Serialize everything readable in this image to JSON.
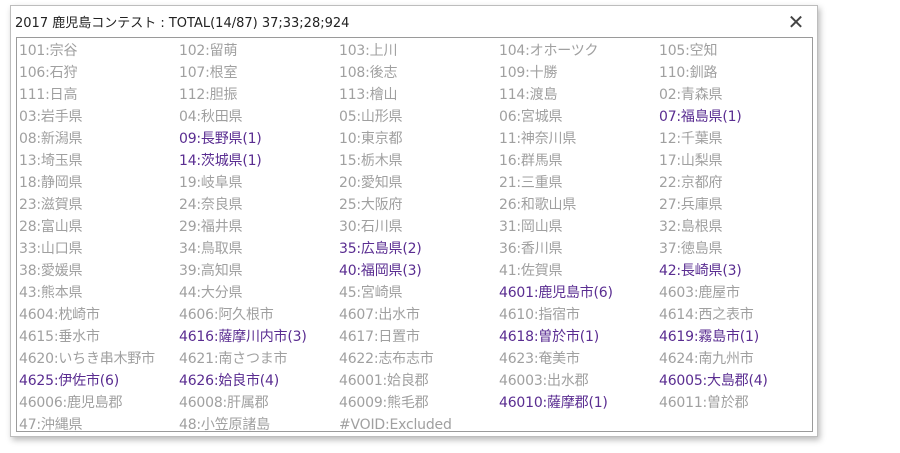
{
  "window": {
    "title": "2017 鹿児島コンテスト : TOTAL(14/87) 37;33;28;924",
    "close_glyph": "✕"
  },
  "colors": {
    "inactive": "#a0a0a0",
    "active": "#5a2d91"
  },
  "items": [
    {
      "label": "101:宗谷",
      "active": false
    },
    {
      "label": "102:留萌",
      "active": false
    },
    {
      "label": "103:上川",
      "active": false
    },
    {
      "label": "104:オホーツク",
      "active": false
    },
    {
      "label": "105:空知",
      "active": false
    },
    {
      "label": "106:石狩",
      "active": false
    },
    {
      "label": "107:根室",
      "active": false
    },
    {
      "label": "108:後志",
      "active": false
    },
    {
      "label": "109:十勝",
      "active": false
    },
    {
      "label": "110:釧路",
      "active": false
    },
    {
      "label": "111:日高",
      "active": false
    },
    {
      "label": "112:胆振",
      "active": false
    },
    {
      "label": "113:檜山",
      "active": false
    },
    {
      "label": "114:渡島",
      "active": false
    },
    {
      "label": "02:青森県",
      "active": false
    },
    {
      "label": "03:岩手県",
      "active": false
    },
    {
      "label": "04:秋田県",
      "active": false
    },
    {
      "label": "05:山形県",
      "active": false
    },
    {
      "label": "06:宮城県",
      "active": false
    },
    {
      "label": "07:福島県(1)",
      "active": true
    },
    {
      "label": "08:新潟県",
      "active": false
    },
    {
      "label": "09:長野県(1)",
      "active": true
    },
    {
      "label": "10:東京都",
      "active": false
    },
    {
      "label": "11:神奈川県",
      "active": false
    },
    {
      "label": "12:千葉県",
      "active": false
    },
    {
      "label": "13:埼玉県",
      "active": false
    },
    {
      "label": "14:茨城県(1)",
      "active": true
    },
    {
      "label": "15:栃木県",
      "active": false
    },
    {
      "label": "16:群馬県",
      "active": false
    },
    {
      "label": "17:山梨県",
      "active": false
    },
    {
      "label": "18:静岡県",
      "active": false
    },
    {
      "label": "19:岐阜県",
      "active": false
    },
    {
      "label": "20:愛知県",
      "active": false
    },
    {
      "label": "21:三重県",
      "active": false
    },
    {
      "label": "22:京都府",
      "active": false
    },
    {
      "label": "23:滋賀県",
      "active": false
    },
    {
      "label": "24:奈良県",
      "active": false
    },
    {
      "label": "25:大阪府",
      "active": false
    },
    {
      "label": "26:和歌山県",
      "active": false
    },
    {
      "label": "27:兵庫県",
      "active": false
    },
    {
      "label": "28:富山県",
      "active": false
    },
    {
      "label": "29:福井県",
      "active": false
    },
    {
      "label": "30:石川県",
      "active": false
    },
    {
      "label": "31:岡山県",
      "active": false
    },
    {
      "label": "32:島根県",
      "active": false
    },
    {
      "label": "33:山口県",
      "active": false
    },
    {
      "label": "34:鳥取県",
      "active": false
    },
    {
      "label": "35:広島県(2)",
      "active": true
    },
    {
      "label": "36:香川県",
      "active": false
    },
    {
      "label": "37:徳島県",
      "active": false
    },
    {
      "label": "38:愛媛県",
      "active": false
    },
    {
      "label": "39:高知県",
      "active": false
    },
    {
      "label": "40:福岡県(3)",
      "active": true
    },
    {
      "label": "41:佐賀県",
      "active": false
    },
    {
      "label": "42:長崎県(3)",
      "active": true
    },
    {
      "label": "43:熊本県",
      "active": false
    },
    {
      "label": "44:大分県",
      "active": false
    },
    {
      "label": "45:宮崎県",
      "active": false
    },
    {
      "label": "4601:鹿児島市(6)",
      "active": true
    },
    {
      "label": "4603:鹿屋市",
      "active": false
    },
    {
      "label": "4604:枕崎市",
      "active": false
    },
    {
      "label": "4606:阿久根市",
      "active": false
    },
    {
      "label": "4607:出水市",
      "active": false
    },
    {
      "label": "4610:指宿市",
      "active": false
    },
    {
      "label": "4614:西之表市",
      "active": false
    },
    {
      "label": "4615:垂水市",
      "active": false
    },
    {
      "label": "4616:薩摩川内市(3)",
      "active": true
    },
    {
      "label": "4617:日置市",
      "active": false
    },
    {
      "label": "4618:曽於市(1)",
      "active": true
    },
    {
      "label": "4619:霧島市(1)",
      "active": true
    },
    {
      "label": "4620:いちき串木野市",
      "active": false
    },
    {
      "label": "4621:南さつま市",
      "active": false
    },
    {
      "label": "4622:志布志市",
      "active": false
    },
    {
      "label": "4623:奄美市",
      "active": false
    },
    {
      "label": "4624:南九州市",
      "active": false
    },
    {
      "label": "4625:伊佐市(6)",
      "active": true
    },
    {
      "label": "4626:姶良市(4)",
      "active": true
    },
    {
      "label": "46001:姶良郡",
      "active": false
    },
    {
      "label": "46003:出水郡",
      "active": false
    },
    {
      "label": "46005:大島郡(4)",
      "active": true
    },
    {
      "label": "46006:鹿児島郡",
      "active": false
    },
    {
      "label": "46008:肝属郡",
      "active": false
    },
    {
      "label": "46009:熊毛郡",
      "active": false
    },
    {
      "label": "46010:薩摩郡(1)",
      "active": true
    },
    {
      "label": "46011:曽於郡",
      "active": false
    },
    {
      "label": "47:沖縄県",
      "active": false
    },
    {
      "label": "48:小笠原諸島",
      "active": false
    },
    {
      "label": "#VOID:Excluded",
      "active": false
    }
  ]
}
